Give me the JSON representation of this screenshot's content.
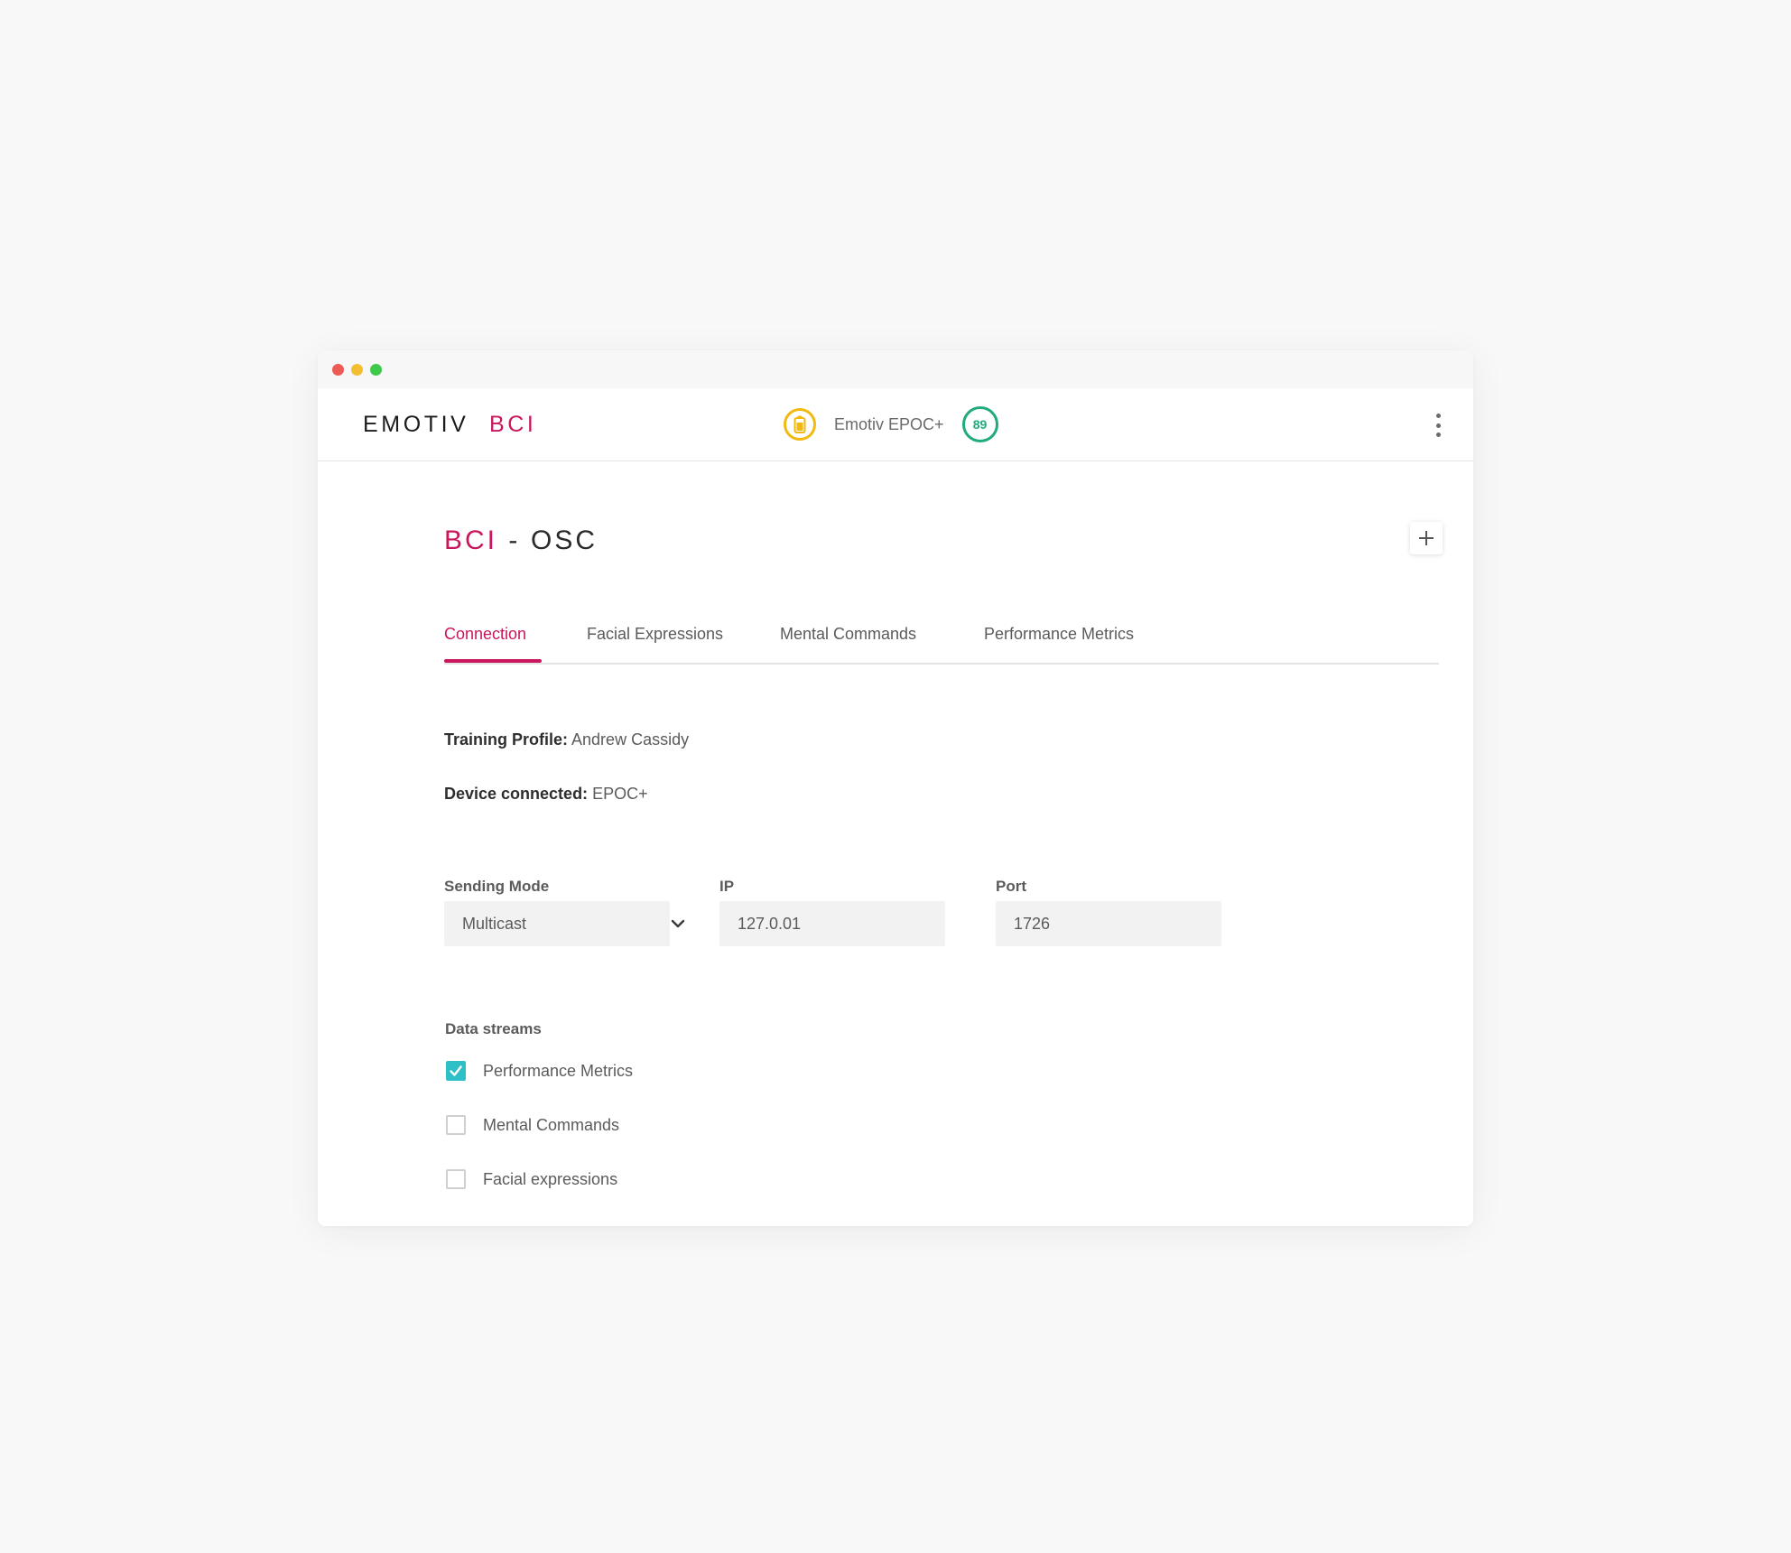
{
  "app": {
    "logo_primary": "EMOTIV",
    "logo_accent": "BCI"
  },
  "device": {
    "battery_icon": "battery-icon",
    "name": "Emotiv EPOC+",
    "contact_quality": "89"
  },
  "page": {
    "title_accent": "BCI",
    "title_separator": " - ",
    "title_rest": "OSC"
  },
  "tabs": [
    {
      "label": "Connection",
      "active": true
    },
    {
      "label": "Facial Expressions",
      "active": false
    },
    {
      "label": "Mental Commands",
      "active": false
    },
    {
      "label": "Performance Metrics",
      "active": false
    }
  ],
  "info": {
    "training_profile_label": "Training Profile:",
    "training_profile_value": "Andrew Cassidy",
    "device_connected_label": "Device connected:",
    "device_connected_value": "EPOC+"
  },
  "form": {
    "sending_mode_label": "Sending Mode",
    "sending_mode_value": "Multicast",
    "ip_label": "IP",
    "ip_value": "127.0.01",
    "port_label": "Port",
    "port_value": "1726"
  },
  "data_streams": {
    "label": "Data streams",
    "items": [
      {
        "label": "Performance Metrics",
        "checked": true
      },
      {
        "label": "Mental Commands",
        "checked": false
      },
      {
        "label": "Facial expressions",
        "checked": false
      }
    ]
  },
  "colors": {
    "accent": "#c8175d",
    "battery": "#f2b90f",
    "quality": "#1fac7a",
    "checkbox": "#2fbfc6"
  }
}
